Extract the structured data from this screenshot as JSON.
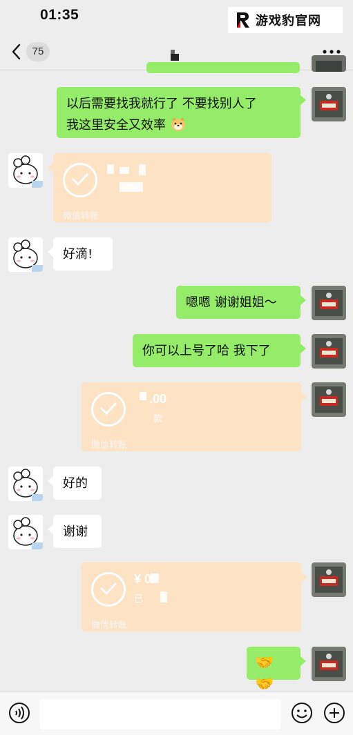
{
  "status": {
    "time": "01:35"
  },
  "watermark": {
    "text": "游戏豹官网"
  },
  "nav": {
    "unread_count": "75"
  },
  "messages": {
    "m1": {
      "line1": "以后需要找我就行了 不要找别人了",
      "line2": "我这里安全又效率"
    },
    "t1": {
      "label": "微信转账"
    },
    "m2": {
      "text": "好滴!"
    },
    "m3": {
      "text": "嗯嗯 谢谢姐姐～"
    },
    "m4": {
      "text": "你可以上号了哈 我下了"
    },
    "t2": {
      "amount": ".00",
      "sub": "款",
      "label": "微信转账"
    },
    "m5": {
      "text": "好的"
    },
    "m6": {
      "text": "谢谢"
    },
    "t3": {
      "amount": "¥ 0",
      "sub": "已",
      "label": "微信转账"
    },
    "m7": {
      "text": "🤝🤝"
    }
  },
  "colors": {
    "bg": "#ededed",
    "green_bubble": "#95ec69",
    "transfer": "#fde2c3"
  }
}
